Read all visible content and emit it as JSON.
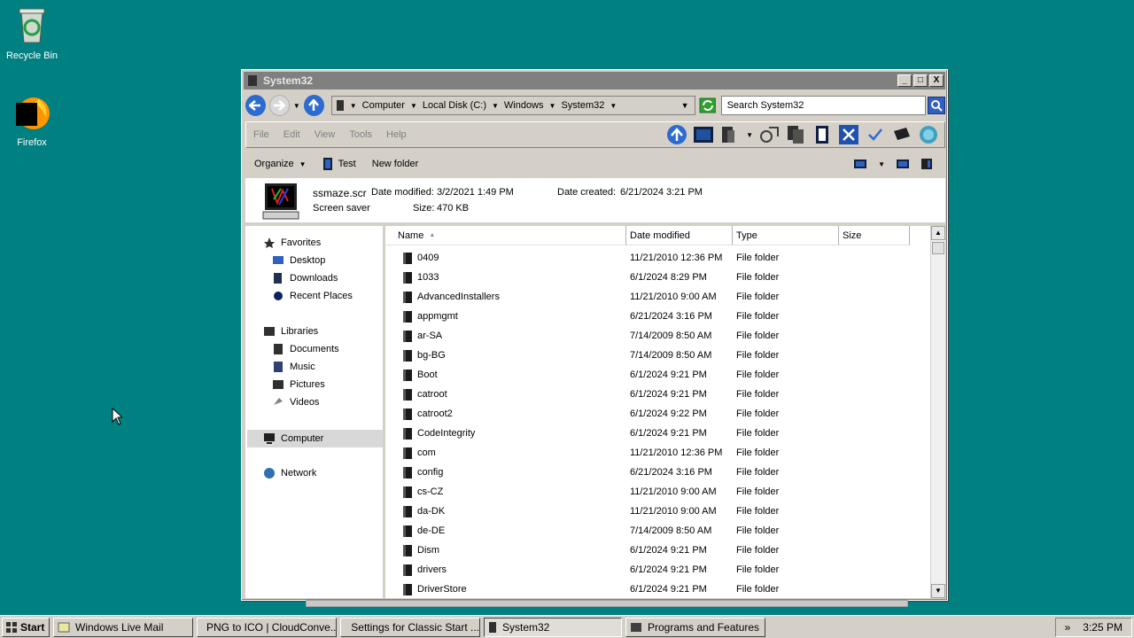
{
  "desktop": {
    "recycle_bin": "Recycle Bin",
    "firefox": "Firefox"
  },
  "window": {
    "title": "System32",
    "min_label": "_",
    "max_label": "□",
    "close_label": "X"
  },
  "address": {
    "breadcrumbs": [
      "Computer",
      "Local Disk (C:)",
      "Windows",
      "System32"
    ],
    "search_placeholder": "Search System32"
  },
  "menu": [
    "File",
    "Edit",
    "View",
    "Tools",
    "Help"
  ],
  "commands": {
    "organize": "Organize",
    "test": "Test",
    "new_folder": "New folder"
  },
  "details": {
    "filename": "ssmaze.scr",
    "type": "Screen saver",
    "modified_label": "Date modified:",
    "modified_value": "3/2/2021 1:49 PM",
    "size_label": "Size:",
    "size_value": "470 KB",
    "created_label": "Date created:",
    "created_value": "6/21/2024 3:21 PM"
  },
  "nav": {
    "favorites": "Favorites",
    "desktop": "Desktop",
    "downloads": "Downloads",
    "recent": "Recent Places",
    "libraries": "Libraries",
    "documents": "Documents",
    "music": "Music",
    "pictures": "Pictures",
    "videos": "Videos",
    "computer": "Computer",
    "network": "Network"
  },
  "columns": {
    "name": "Name",
    "date": "Date modified",
    "type": "Type",
    "size": "Size"
  },
  "files": [
    {
      "name": "0409",
      "date": "11/21/2010 12:36 PM",
      "type": "File folder"
    },
    {
      "name": "1033",
      "date": "6/1/2024 8:29 PM",
      "type": "File folder"
    },
    {
      "name": "AdvancedInstallers",
      "date": "11/21/2010 9:00 AM",
      "type": "File folder"
    },
    {
      "name": "appmgmt",
      "date": "6/21/2024 3:16 PM",
      "type": "File folder"
    },
    {
      "name": "ar-SA",
      "date": "7/14/2009 8:50 AM",
      "type": "File folder"
    },
    {
      "name": "bg-BG",
      "date": "7/14/2009 8:50 AM",
      "type": "File folder"
    },
    {
      "name": "Boot",
      "date": "6/1/2024 9:21 PM",
      "type": "File folder"
    },
    {
      "name": "catroot",
      "date": "6/1/2024 9:21 PM",
      "type": "File folder"
    },
    {
      "name": "catroot2",
      "date": "6/1/2024 9:22 PM",
      "type": "File folder"
    },
    {
      "name": "CodeIntegrity",
      "date": "6/1/2024 9:21 PM",
      "type": "File folder"
    },
    {
      "name": "com",
      "date": "11/21/2010 12:36 PM",
      "type": "File folder"
    },
    {
      "name": "config",
      "date": "6/21/2024 3:16 PM",
      "type": "File folder"
    },
    {
      "name": "cs-CZ",
      "date": "11/21/2010 9:00 AM",
      "type": "File folder"
    },
    {
      "name": "da-DK",
      "date": "11/21/2010 9:00 AM",
      "type": "File folder"
    },
    {
      "name": "de-DE",
      "date": "7/14/2009 8:50 AM",
      "type": "File folder"
    },
    {
      "name": "Dism",
      "date": "6/1/2024 9:21 PM",
      "type": "File folder"
    },
    {
      "name": "drivers",
      "date": "6/1/2024 9:21 PM",
      "type": "File folder"
    },
    {
      "name": "DriverStore",
      "date": "6/1/2024 9:21 PM",
      "type": "File folder"
    }
  ],
  "taskbar": {
    "start": "Start",
    "tasks": [
      "Windows Live Mail",
      "PNG to ICO | CloudConve...",
      "Settings for Classic Start ...",
      "System32",
      "Programs and Features"
    ],
    "tray_chevron": "»",
    "clock": "3:25 PM"
  }
}
